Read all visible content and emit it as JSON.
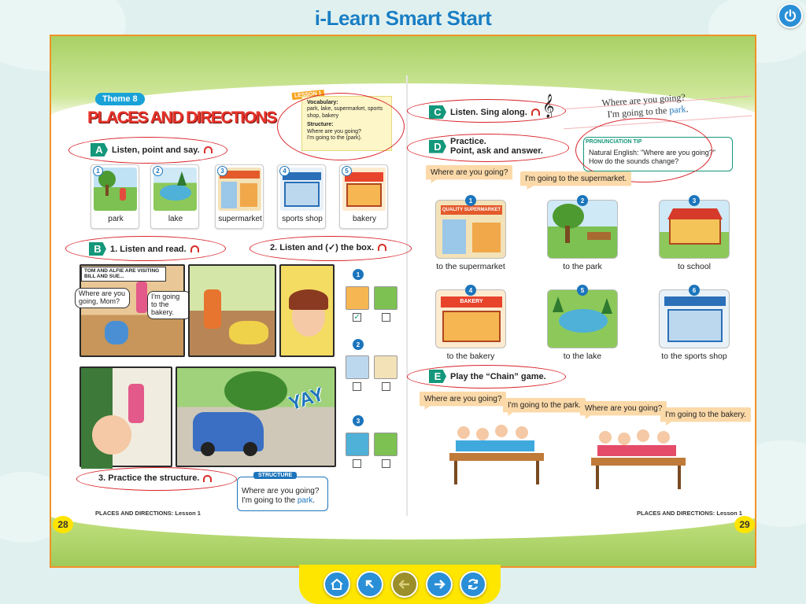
{
  "app": {
    "title": "i-Learn Smart Start"
  },
  "page_left": {
    "number": "28",
    "footer": "PLACES AND DIRECTIONS: Lesson 1",
    "theme": "Theme 8",
    "unit_title": "PLACES AND DIRECTIONS",
    "lesson_tag": "LESSON 1",
    "vocab": {
      "heading": "Vocabulary:",
      "words": "park, lake, supermarket, sports shop, bakery",
      "structure_heading": "Structure:",
      "structure_lines": [
        "Where are you going?",
        "I'm going to the (park)."
      ]
    },
    "section_a": {
      "letter": "A",
      "title": "Listen, point and say."
    },
    "cards": [
      {
        "num": "1",
        "label": "park"
      },
      {
        "num": "2",
        "label": "lake"
      },
      {
        "num": "3",
        "label": "supermarket"
      },
      {
        "num": "4",
        "label": "sports shop"
      },
      {
        "num": "5",
        "label": "bakery"
      }
    ],
    "section_b": {
      "letter": "B",
      "title": "1. Listen and read.",
      "task2": "2. Listen and (✓) the box."
    },
    "comic": {
      "caption": "TOM AND ALFIE ARE VISITING BILL AND SUE...",
      "bubble1": "Where are you going, Mom?",
      "bubble2": "I'm going to the bakery.",
      "yay": "YAY"
    },
    "checks": [
      {
        "num": "1"
      },
      {
        "num": "2"
      },
      {
        "num": "3"
      }
    ],
    "task3": "3. Practice the structure.",
    "structure_box": {
      "tag": "STRUCTURE",
      "line1": "Where are you going?",
      "line2_pre": "I'm going to the ",
      "line2_hl": "park",
      "line2_end": "."
    }
  },
  "page_right": {
    "number": "29",
    "footer": "PLACES AND DIRECTIONS: Lesson 1",
    "section_c": {
      "letter": "C",
      "title": "Listen. Sing along."
    },
    "sing": {
      "line1": "Where are you going?",
      "line2_pre": "I'm going to the ",
      "line2_hl": "park",
      "line2_end": "."
    },
    "section_d": {
      "letter": "D",
      "title_1": "Practice.",
      "title_2": "Point, ask and answer."
    },
    "tip": {
      "tag": "PRONUNCIATION TIP",
      "line1": "Natural English: \"Where are you going?\"",
      "line2": "How do the sounds change?"
    },
    "d_bubble_q": "Where are you going?",
    "d_bubble_a": "I'm going to the supermarket.",
    "places": [
      {
        "num": "1",
        "label": "to the supermarket",
        "sign": "QUALITY SUPERMARKET"
      },
      {
        "num": "2",
        "label": "to the park"
      },
      {
        "num": "3",
        "label": "to school"
      },
      {
        "num": "4",
        "label": "to the bakery",
        "sign": "BAKERY"
      },
      {
        "num": "5",
        "label": "to the lake"
      },
      {
        "num": "6",
        "label": "to the sports shop"
      }
    ],
    "section_e": {
      "letter": "E",
      "title": "Play the “Chain” game."
    },
    "e_bubbles": [
      "Where are you going?",
      "I'm going to the park.",
      "Where are you going?",
      "I'm going to the bakery."
    ]
  },
  "nav": {
    "buttons": [
      {
        "name": "home-button",
        "icon": "home-icon"
      },
      {
        "name": "back-arrow-button",
        "icon": "up-left-arrow-icon"
      },
      {
        "name": "previous-page-button",
        "icon": "left-arrow-icon"
      },
      {
        "name": "next-page-button",
        "icon": "right-arrow-icon"
      },
      {
        "name": "refresh-button",
        "icon": "refresh-icon"
      }
    ]
  }
}
